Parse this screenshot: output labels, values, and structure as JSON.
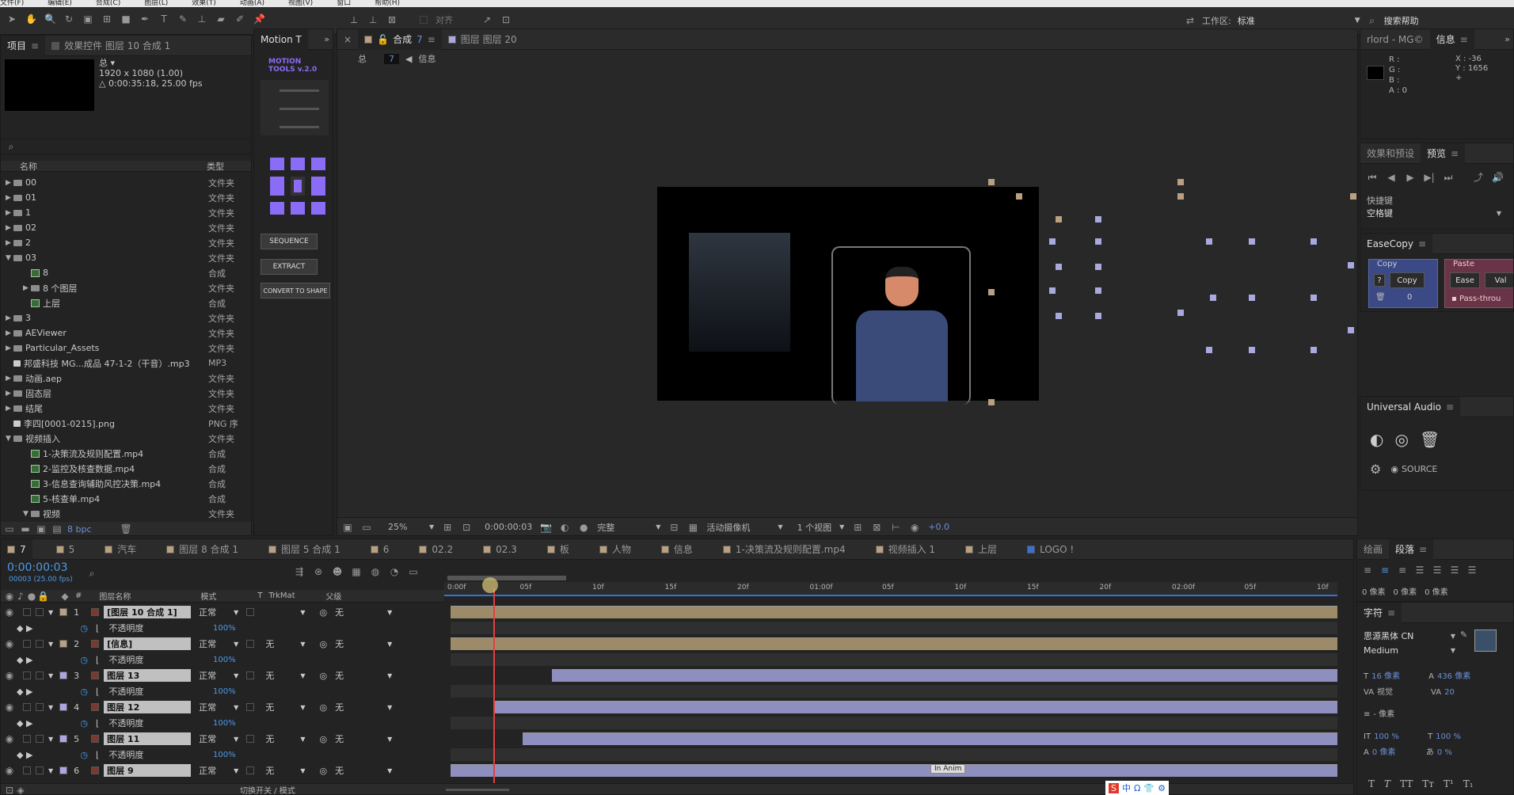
{
  "menubar": {
    "items": [
      "文件(F)",
      "编辑(E)",
      "合成(C)",
      "图层(L)",
      "效果(T)",
      "动画(A)",
      "视图(V)",
      "窗口",
      "帮助(H)"
    ]
  },
  "toolbar": {
    "align_label": "对齐",
    "workspace_label": "工作区:",
    "workspace_value": "标准",
    "search_help": "搜索帮助"
  },
  "project": {
    "tab_label": "项目",
    "effects_tab": "效果控件 图层 10 合成 1",
    "thumb_title": "总 ▾",
    "thumb_res": "1920 x 1080 (1.00)",
    "thumb_dur": "△ 0:00:35:18, 25.00 fps",
    "col_name": "名称",
    "col_type": "类型",
    "bpc": "8 bpc",
    "items": [
      {
        "name": "00",
        "type": "文件夹",
        "kind": "folder",
        "indent": 0,
        "open": false
      },
      {
        "name": "01",
        "type": "文件夹",
        "kind": "folder",
        "indent": 0,
        "open": false
      },
      {
        "name": "1",
        "type": "文件夹",
        "kind": "folder",
        "indent": 0,
        "open": false
      },
      {
        "name": "02",
        "type": "文件夹",
        "kind": "folder",
        "indent": 0,
        "open": false
      },
      {
        "name": "2",
        "type": "文件夹",
        "kind": "folder",
        "indent": 0,
        "open": false
      },
      {
        "name": "03",
        "type": "文件夹",
        "kind": "folder",
        "indent": 0,
        "open": true
      },
      {
        "name": "8",
        "type": "合成",
        "kind": "comp",
        "indent": 1,
        "open": false
      },
      {
        "name": "8 个图层",
        "type": "文件夹",
        "kind": "folder",
        "indent": 1,
        "open": false
      },
      {
        "name": "上层",
        "type": "合成",
        "kind": "comp",
        "indent": 1,
        "open": false
      },
      {
        "name": "3",
        "type": "文件夹",
        "kind": "folder",
        "indent": 0,
        "open": false
      },
      {
        "name": "AEViewer",
        "type": "文件夹",
        "kind": "folder",
        "indent": 0,
        "open": false
      },
      {
        "name": "Particular_Assets",
        "type": "文件夹",
        "kind": "folder",
        "indent": 0,
        "open": false
      },
      {
        "name": "邦盛科技 MG...成品 47-1-2（干音）.mp3",
        "type": "MP3",
        "kind": "file",
        "indent": 0,
        "open": false
      },
      {
        "name": "动画.aep",
        "type": "文件夹",
        "kind": "folder",
        "indent": 0,
        "open": false
      },
      {
        "name": "固态层",
        "type": "文件夹",
        "kind": "folder",
        "indent": 0,
        "open": false
      },
      {
        "name": "结尾",
        "type": "文件夹",
        "kind": "folder",
        "indent": 0,
        "open": false
      },
      {
        "name": "李四[0001-0215].png",
        "type": "PNG 序",
        "kind": "file",
        "indent": 0,
        "open": false
      },
      {
        "name": "视频插入",
        "type": "文件夹",
        "kind": "folder",
        "indent": 0,
        "open": true
      },
      {
        "name": "1-决策流及规则配置.mp4",
        "type": "合成",
        "kind": "comp",
        "indent": 1,
        "open": false
      },
      {
        "name": "2-监控及核查数据.mp4",
        "type": "合成",
        "kind": "comp",
        "indent": 1,
        "open": false
      },
      {
        "name": "3-信息查询辅助风控决策.mp4",
        "type": "合成",
        "kind": "comp",
        "indent": 1,
        "open": false
      },
      {
        "name": "5-核查单.mp4",
        "type": "合成",
        "kind": "comp",
        "indent": 1,
        "open": false
      },
      {
        "name": "视频",
        "type": "文件夹",
        "kind": "folder",
        "indent": 1,
        "open": true
      }
    ]
  },
  "motion": {
    "tab": "Motion T",
    "title": "MOTION\nTOOLS v.2.0",
    "sequence": "SEQUENCE",
    "extract": "EXTRACT",
    "convert": "CONVERT TO SHAPE"
  },
  "comp": {
    "tab1": "合成",
    "tab1_num": "7",
    "tab2": "图层 图层 20",
    "crumb1": "总",
    "crumb_num": "7",
    "crumb2": "信息",
    "zoom": "25%",
    "time": "0:00:00:03",
    "quality": "完整",
    "camera": "活动摄像机",
    "views": "1 个视图",
    "offset": "+0.0"
  },
  "info": {
    "tab_left": "rlord - MG©",
    "tab": "信息",
    "r": "R :",
    "g": "G :",
    "b": "B :",
    "a": "A : 0",
    "x": "X : -36",
    "y": "Y : 1656"
  },
  "preview": {
    "tab_fx": "效果和预设",
    "tab": "预览",
    "shortcut_label": "快捷键",
    "shortcut_value": "空格键"
  },
  "easecopy": {
    "title": "EaseCopy",
    "copy_title": "Copy",
    "paste_title": "Paste",
    "q": "?",
    "copy_btn": "Copy",
    "ease_btn": "Ease",
    "val_btn": "Val",
    "zero": "0",
    "pass": "Pass-throu"
  },
  "audio": {
    "title": "Universal Audio",
    "source": "SOURCE"
  },
  "timeline": {
    "tabs": [
      "7",
      "5",
      "汽车",
      "图层 8 合成 1",
      "图层 5 合成 1",
      "6",
      "02.2",
      "02.3",
      "板",
      "人物",
      "信息",
      "1-决策流及规则配置.mp4",
      "视频插入 1",
      "上层",
      "LOGO !"
    ],
    "timecode": "0:00:00:03",
    "frames": "00003 (25.00 fps)",
    "col_layer": "图层名称",
    "col_mode": "模式",
    "col_t": "T",
    "col_trkmat": "TrkMat",
    "col_parent": "父级",
    "ruler": [
      "0:00f",
      "05f",
      "10f",
      "15f",
      "20f",
      "01:00f",
      "05f",
      "10f",
      "15f",
      "20f",
      "02:00f",
      "05f",
      "10f"
    ],
    "layers": [
      {
        "num": "1",
        "name": "[图层 10 合成 1]",
        "mode": "正常",
        "trk": "",
        "parent": "无",
        "color": "#b8a080",
        "prop": "不透明度",
        "val": "100%",
        "start": 0.0
      },
      {
        "num": "2",
        "name": "[信息]",
        "mode": "正常",
        "trk": "无",
        "parent": "无",
        "color": "#b8a080",
        "prop": "不透明度",
        "val": "100%",
        "start": 0.0
      },
      {
        "num": "3",
        "name": "图层 13",
        "mode": "正常",
        "trk": "无",
        "parent": "无",
        "color": "#a9a9e0",
        "prop": "不透明度",
        "val": "100%",
        "start": 0.115
      },
      {
        "num": "4",
        "name": "图层 12",
        "mode": "正常",
        "trk": "无",
        "parent": "无",
        "color": "#a9a9e0",
        "prop": "不透明度",
        "val": "100%",
        "start": 0.05
      },
      {
        "num": "5",
        "name": "图层 11",
        "mode": "正常",
        "trk": "无",
        "parent": "无",
        "color": "#a9a9e0",
        "prop": "不透明度",
        "val": "100%",
        "start": 0.082
      },
      {
        "num": "6",
        "name": "图层 9",
        "mode": "正常",
        "trk": "无",
        "parent": "无",
        "color": "#a9a9e0",
        "prop": "",
        "val": "",
        "start": 0.0
      }
    ],
    "anim_label": "In Anim",
    "footer": "切换开关 / 模式"
  },
  "paragraph": {
    "tab1": "绘画",
    "tab2": "段落",
    "pix_a": "0 像素",
    "pix_b": "0 像素",
    "pix_c": "0 像素"
  },
  "character": {
    "tab": "字符",
    "font": "思源黑体 CN",
    "style": "Medium",
    "size": "16 像素",
    "leading": "436 像素",
    "kerning": "视觉",
    "tracking": "20",
    "indent": "- 像素",
    "vscale": "100 %",
    "hscale": "100 %",
    "baseline": "0 像素",
    "tsume": "0 %"
  },
  "ime": {
    "items": [
      "S",
      "中",
      "Ω",
      "👕",
      "⚙"
    ]
  }
}
